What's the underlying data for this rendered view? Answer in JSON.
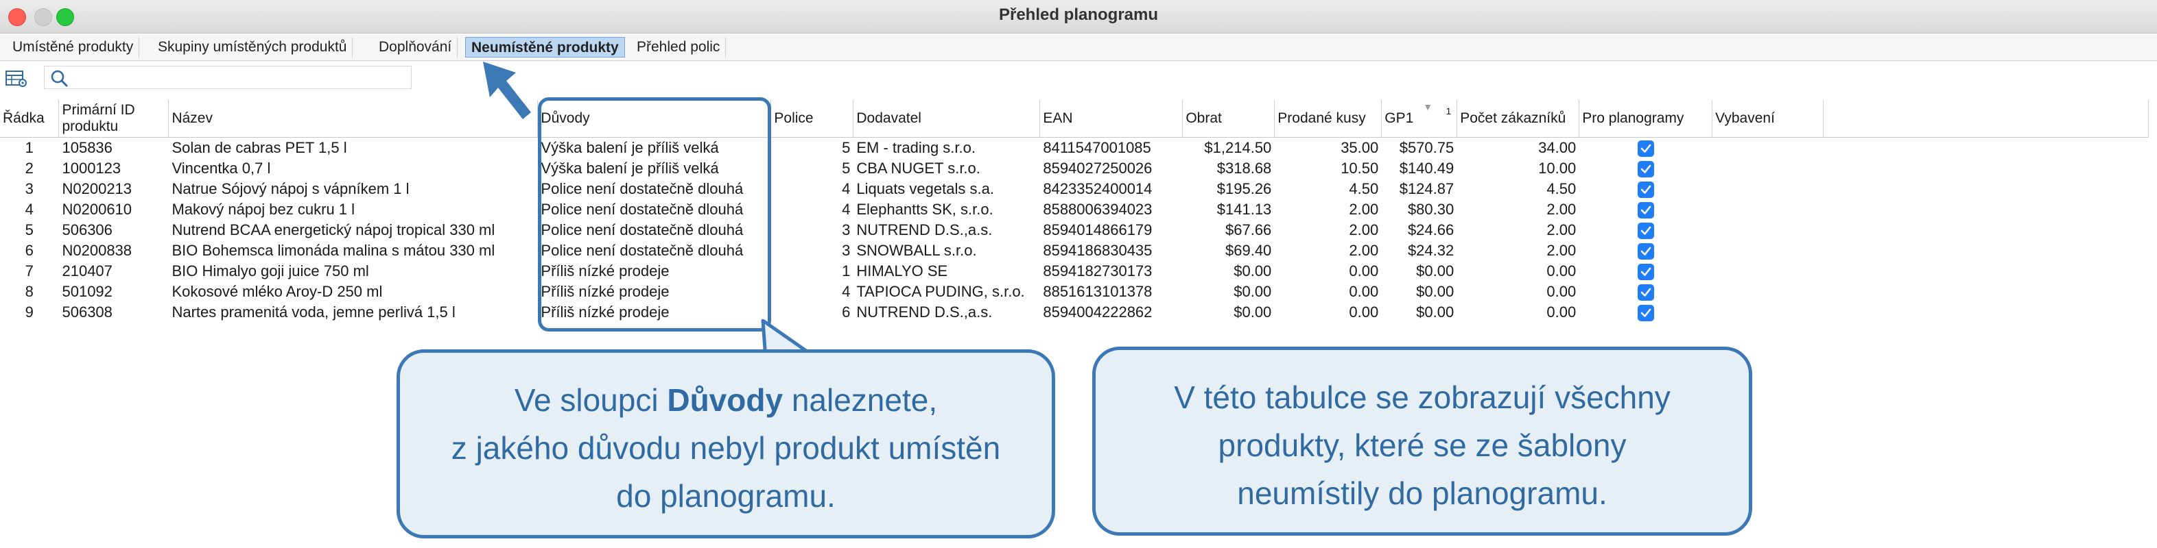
{
  "window": {
    "title": "Přehled planogramu"
  },
  "tabs": [
    {
      "label": "Umístěné produkty",
      "active": false
    },
    {
      "label": "Skupiny umístěných produktů",
      "active": false
    },
    {
      "label": "Doplňování",
      "active": false
    },
    {
      "label": "Neumístěné produkty",
      "active": true
    },
    {
      "label": "Přehled polic",
      "active": false
    }
  ],
  "toolbar": {
    "settings_icon": "table-settings-icon",
    "search_icon": "search-icon",
    "search_value": ""
  },
  "table": {
    "headers": {
      "radka": "Řádka",
      "primarni_id_1": "Primární ID",
      "primarni_id_2": "produktu",
      "nazev": "Název",
      "duvody": "Důvody",
      "police": "Police",
      "dodavatel": "Dodavatel",
      "ean": "EAN",
      "obrat": "Obrat",
      "prodane_kusy": "Prodané kusy",
      "gp1": "GP1",
      "gp1_sort_index": "1",
      "pocet_zakazniku": "Počet zákazníků",
      "pro_planogramy": "Pro planogramy",
      "vybaveni": "Vybavení"
    },
    "rows": [
      {
        "radka": "1",
        "id": "105836",
        "nazev": "Solan de cabras PET 1,5 l",
        "duvody": "Výška balení je příliš velká",
        "police": "5",
        "dodavatel": "EM - trading s.r.o.",
        "ean": "8411547001085",
        "obrat": "$1,214.50",
        "kusy": "35.00",
        "gp1": "$570.75",
        "zakaznici": "34.00",
        "pro_planogramy": true
      },
      {
        "radka": "2",
        "id": "1000123",
        "nazev": "Vincentka 0,7 l",
        "duvody": "Výška balení je příliš velká",
        "police": "5",
        "dodavatel": "CBA NUGET s.r.o.",
        "ean": "8594027250026",
        "obrat": "$318.68",
        "kusy": "10.50",
        "gp1": "$140.49",
        "zakaznici": "10.00",
        "pro_planogramy": true
      },
      {
        "radka": "3",
        "id": "N0200213",
        "nazev": "Natrue Sójový nápoj s vápníkem 1 l",
        "duvody": "Police není dostatečně dlouhá",
        "police": "4",
        "dodavatel": "Liquats vegetals s.a.",
        "ean": "8423352400014",
        "obrat": "$195.26",
        "kusy": "4.50",
        "gp1": "$124.87",
        "zakaznici": "4.50",
        "pro_planogramy": true
      },
      {
        "radka": "4",
        "id": "N0200610",
        "nazev": "Makový nápoj bez cukru 1 l",
        "duvody": "Police není dostatečně dlouhá",
        "police": "4",
        "dodavatel": "Elephantts SK, s.r.o.",
        "ean": "8588006394023",
        "obrat": "$141.13",
        "kusy": "2.00",
        "gp1": "$80.30",
        "zakaznici": "2.00",
        "pro_planogramy": true
      },
      {
        "radka": "5",
        "id": "506306",
        "nazev": "Nutrend BCAA energetický nápoj tropical 330 ml",
        "duvody": "Police není dostatečně dlouhá",
        "police": "3",
        "dodavatel": "NUTREND D.S.,a.s.",
        "ean": "8594014866179",
        "obrat": "$67.66",
        "kusy": "2.00",
        "gp1": "$24.66",
        "zakaznici": "2.00",
        "pro_planogramy": true
      },
      {
        "radka": "6",
        "id": "N0200838",
        "nazev": "BIO Bohemsca limonáda malina s mátou 330 ml",
        "duvody": "Police není dostatečně dlouhá",
        "police": "3",
        "dodavatel": "SNOWBALL s.r.o.",
        "ean": "8594186830435",
        "obrat": "$69.40",
        "kusy": "2.00",
        "gp1": "$24.32",
        "zakaznici": "2.00",
        "pro_planogramy": true
      },
      {
        "radka": "7",
        "id": "210407",
        "nazev": "BIO Himalyo goji juice 750 ml",
        "duvody": "Příliš nízké prodeje",
        "police": "1",
        "dodavatel": "HIMALYO SE",
        "ean": "8594182730173",
        "obrat": "$0.00",
        "kusy": "0.00",
        "gp1": "$0.00",
        "zakaznici": "0.00",
        "pro_planogramy": true
      },
      {
        "radka": "8",
        "id": "501092",
        "nazev": "Kokosové mléko Aroy-D 250 ml",
        "duvody": "Příliš nízké prodeje",
        "police": "4",
        "dodavatel": "TAPIOCA PUDING, s.r.o.",
        "ean": "8851613101378",
        "obrat": "$0.00",
        "kusy": "0.00",
        "gp1": "$0.00",
        "zakaznici": "0.00",
        "pro_planogramy": true
      },
      {
        "radka": "9",
        "id": "506308",
        "nazev": "Nartes pramenitá voda, jemne perlivá 1,5 l",
        "duvody": "Příliš nízké prodeje",
        "police": "6",
        "dodavatel": "NUTREND D.S.,a.s.",
        "ean": "8594004222862",
        "obrat": "$0.00",
        "kusy": "0.00",
        "gp1": "$0.00",
        "zakaznici": "0.00",
        "pro_planogramy": true
      }
    ]
  },
  "callouts": {
    "left": {
      "line1_pre": "Ve sloupci ",
      "line1_bold": "Důvody",
      "line1_post": " naleznete,",
      "line2": "z jakého důvodu nebyl produkt umístěn",
      "line3": "do planogramu."
    },
    "right": {
      "line1": "V této tabulce se zobrazují všechny",
      "line2": "produkty, které se ze šablony",
      "line3": "neumístily do planogramu."
    }
  },
  "colors": {
    "accent": "#3b78b5",
    "callout_bg": "#e6eef6",
    "checkbox": "#1f7df7",
    "active_tab": "#bcd7f2"
  }
}
